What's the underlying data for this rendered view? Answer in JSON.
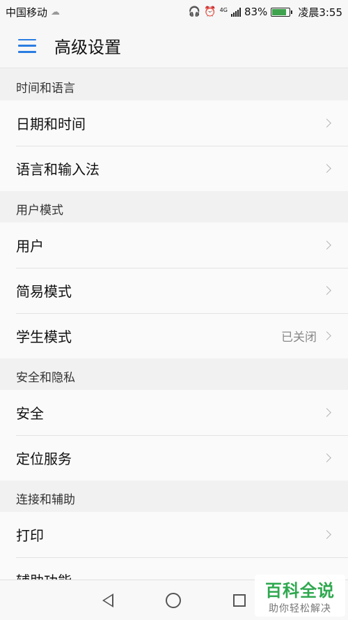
{
  "status_bar": {
    "carrier": "中国移动",
    "network": "4G",
    "battery": "83%",
    "battery_level": 0.83,
    "time": "凌晨3:55"
  },
  "app_bar": {
    "title": "高级设置"
  },
  "sections": [
    {
      "header": "时间和语言",
      "items": [
        {
          "label": "日期和时间",
          "value": ""
        },
        {
          "label": "语言和输入法",
          "value": ""
        }
      ]
    },
    {
      "header": "用户模式",
      "items": [
        {
          "label": "用户",
          "value": ""
        },
        {
          "label": "简易模式",
          "value": ""
        },
        {
          "label": "学生模式",
          "value": "已关闭"
        }
      ]
    },
    {
      "header": "安全和隐私",
      "items": [
        {
          "label": "安全",
          "value": ""
        },
        {
          "label": "定位服务",
          "value": ""
        }
      ]
    },
    {
      "header": "连接和辅助",
      "items": [
        {
          "label": "打印",
          "value": ""
        },
        {
          "label": "辅助功能",
          "value": ""
        }
      ]
    }
  ],
  "watermark": {
    "title": "百科全说",
    "subtitle": "助你轻松解决"
  },
  "colors": {
    "accent": "#2a7de1",
    "battery": "#3fa34d",
    "watermark": "#2fa84f"
  }
}
